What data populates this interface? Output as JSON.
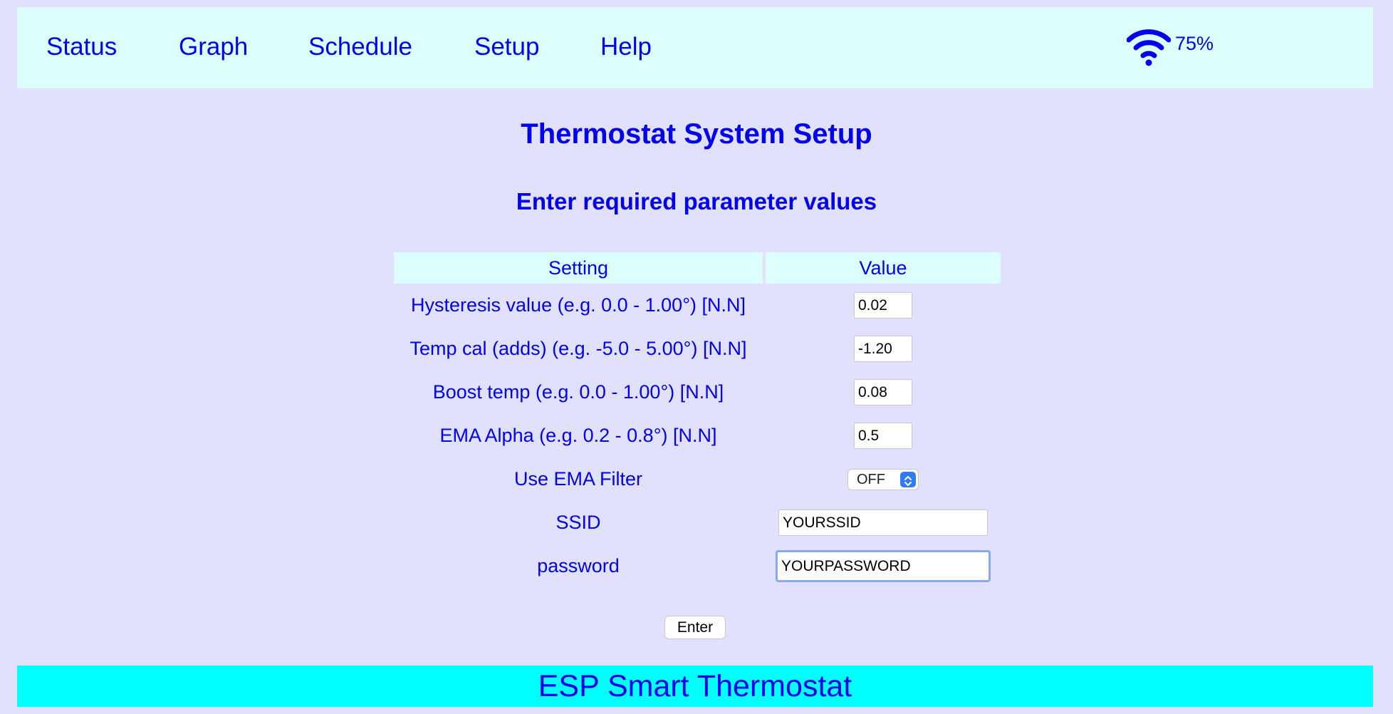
{
  "nav": {
    "items": [
      {
        "label": "Status"
      },
      {
        "label": "Graph"
      },
      {
        "label": "Schedule"
      },
      {
        "label": "Setup"
      },
      {
        "label": "Help"
      }
    ],
    "wifi": {
      "icon": "wifi-icon",
      "signal": "75%"
    }
  },
  "title": "Thermostat System Setup",
  "subtitle": "Enter required parameter values",
  "table": {
    "headers": {
      "setting": "Setting",
      "value": "Value"
    },
    "rows": [
      {
        "label": "Hysteresis value (e.g. 0.0 - 1.00°) [N.N]",
        "value": "0.02"
      },
      {
        "label": "Temp cal (adds) (e.g. -5.0 - 5.00°) [N.N]",
        "value": "-1.20"
      },
      {
        "label": "Boost temp (e.g. 0.0 - 1.00°) [N.N]",
        "value": "0.08"
      },
      {
        "label": "EMA Alpha (e.g. 0.2 - 0.8°) [N.N]",
        "value": "0.5"
      },
      {
        "label": "Use EMA Filter",
        "value": "OFF"
      },
      {
        "label": "SSID",
        "value": "YOURSSID"
      },
      {
        "label": "password",
        "value": "YOURPASSWORD"
      }
    ]
  },
  "enter_label": "Enter",
  "footer": "ESP Smart Thermostat",
  "colors": {
    "background": "#e1e1fd",
    "nav_background": "#dcfffd",
    "footer_background": "#00ffff",
    "text": "#0000ee",
    "select_accent": "#2f7cf6"
  }
}
